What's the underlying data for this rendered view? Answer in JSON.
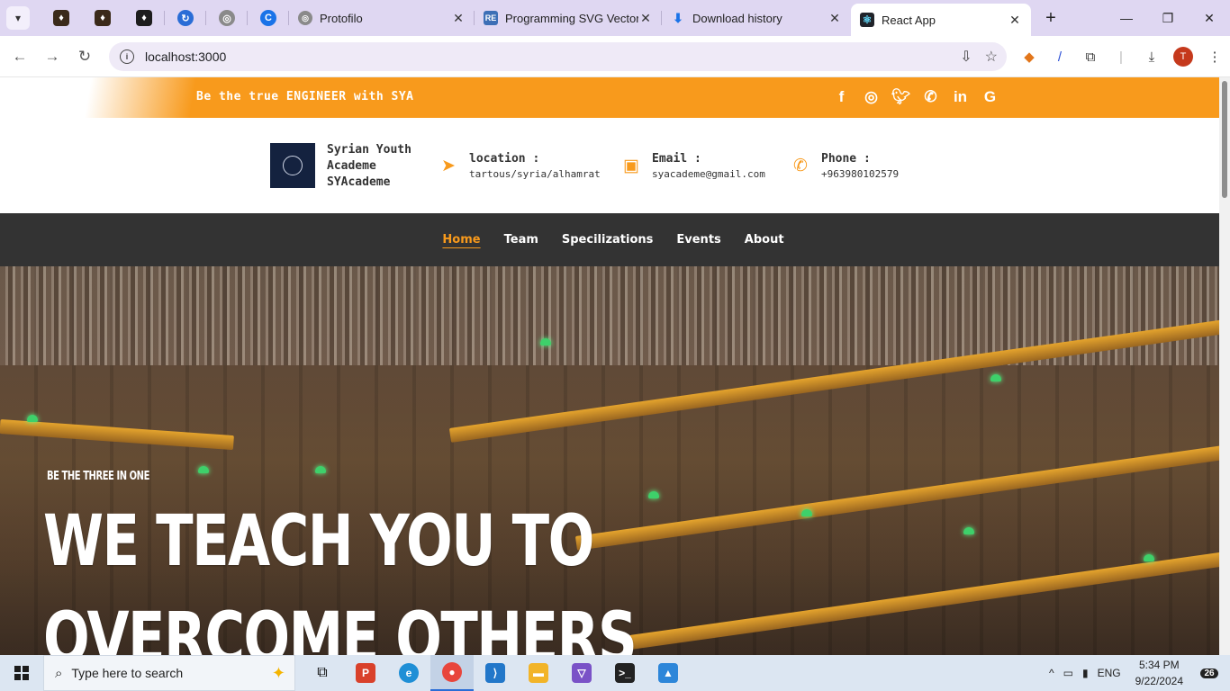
{
  "browser": {
    "tabs": [
      {
        "label": "Protofilo",
        "icon": "globe-icon"
      },
      {
        "label": "Programming SVG Vector",
        "icon": "repo-icon"
      },
      {
        "label": "Download history",
        "icon": "download-icon"
      },
      {
        "label": "React App",
        "icon": "react-icon"
      }
    ],
    "address": "localhost:3000",
    "profile_initial": "T"
  },
  "site": {
    "tagline": "Be the true ENGINEER with SYA",
    "brand": {
      "line1": "Syrian Youth",
      "line2": "Academe",
      "line3": "SYAcademe"
    },
    "contacts": [
      {
        "title": "location :",
        "value": "tartous/syria/alhamrat"
      },
      {
        "title": "Email :",
        "value": "syacademe@gmail.com"
      },
      {
        "title": "Phone :",
        "value": "+963980102579"
      }
    ],
    "nav": [
      "Home",
      "Team",
      "Specilizations",
      "Events",
      "About"
    ],
    "hero": {
      "subtitle": "BE THE THREE IN ONE",
      "title_line1": "WE TEACH YOU TO",
      "title_line2": "OVERCOME OTHERS"
    },
    "colors": {
      "accent": "#f89a1c",
      "nav_bg": "#333333"
    }
  },
  "taskbar": {
    "search_placeholder": "Type here to search",
    "language": "ENG",
    "time": "5:34 PM",
    "date": "9/22/2024",
    "notifications": "26"
  }
}
